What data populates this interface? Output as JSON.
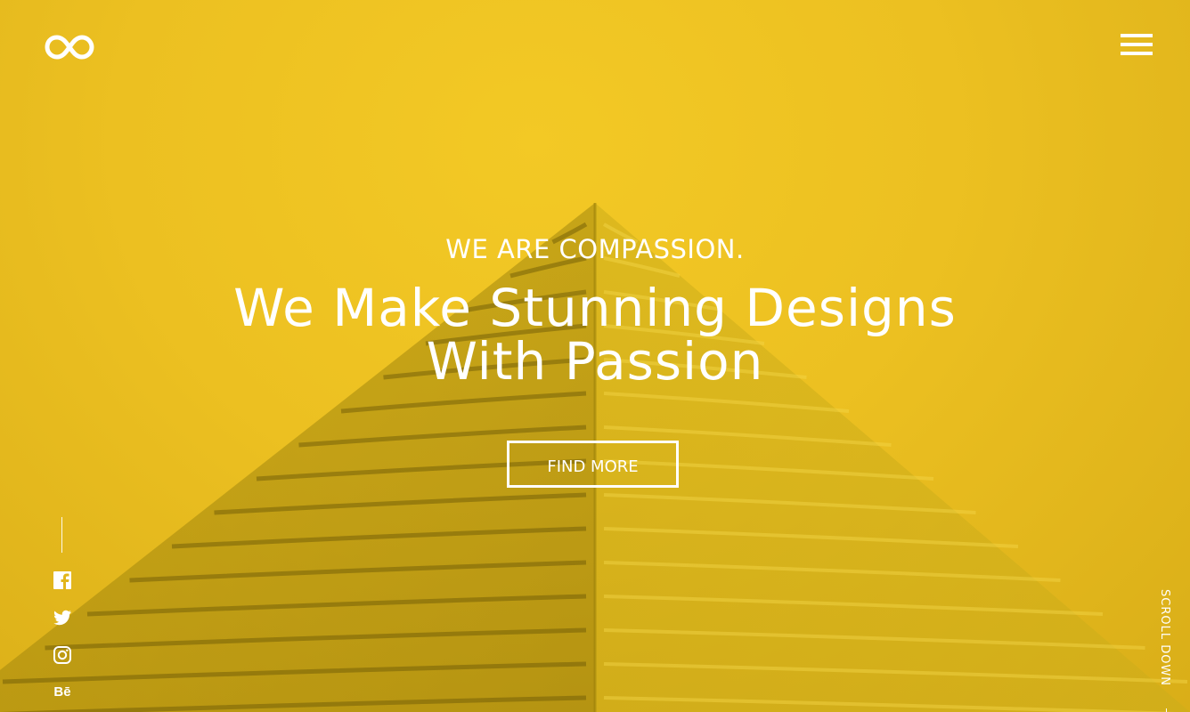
{
  "brand": {
    "logo_icon": "infinity-icon"
  },
  "header": {
    "menu_icon": "hamburger-menu-icon"
  },
  "hero": {
    "kicker": "WE ARE COMPASSION.",
    "headline_line1": "We Make Stunning Designs",
    "headline_line2": "With Passion",
    "cta_label": "FIND MORE",
    "background_color": "#ecc021",
    "text_color": "#ffffff"
  },
  "social": {
    "items": [
      {
        "icon": "facebook-icon"
      },
      {
        "icon": "twitter-icon"
      },
      {
        "icon": "instagram-icon"
      },
      {
        "icon": "behance-icon",
        "text": "Bē"
      }
    ]
  },
  "scroll": {
    "label": "SCROLL DOWN"
  }
}
